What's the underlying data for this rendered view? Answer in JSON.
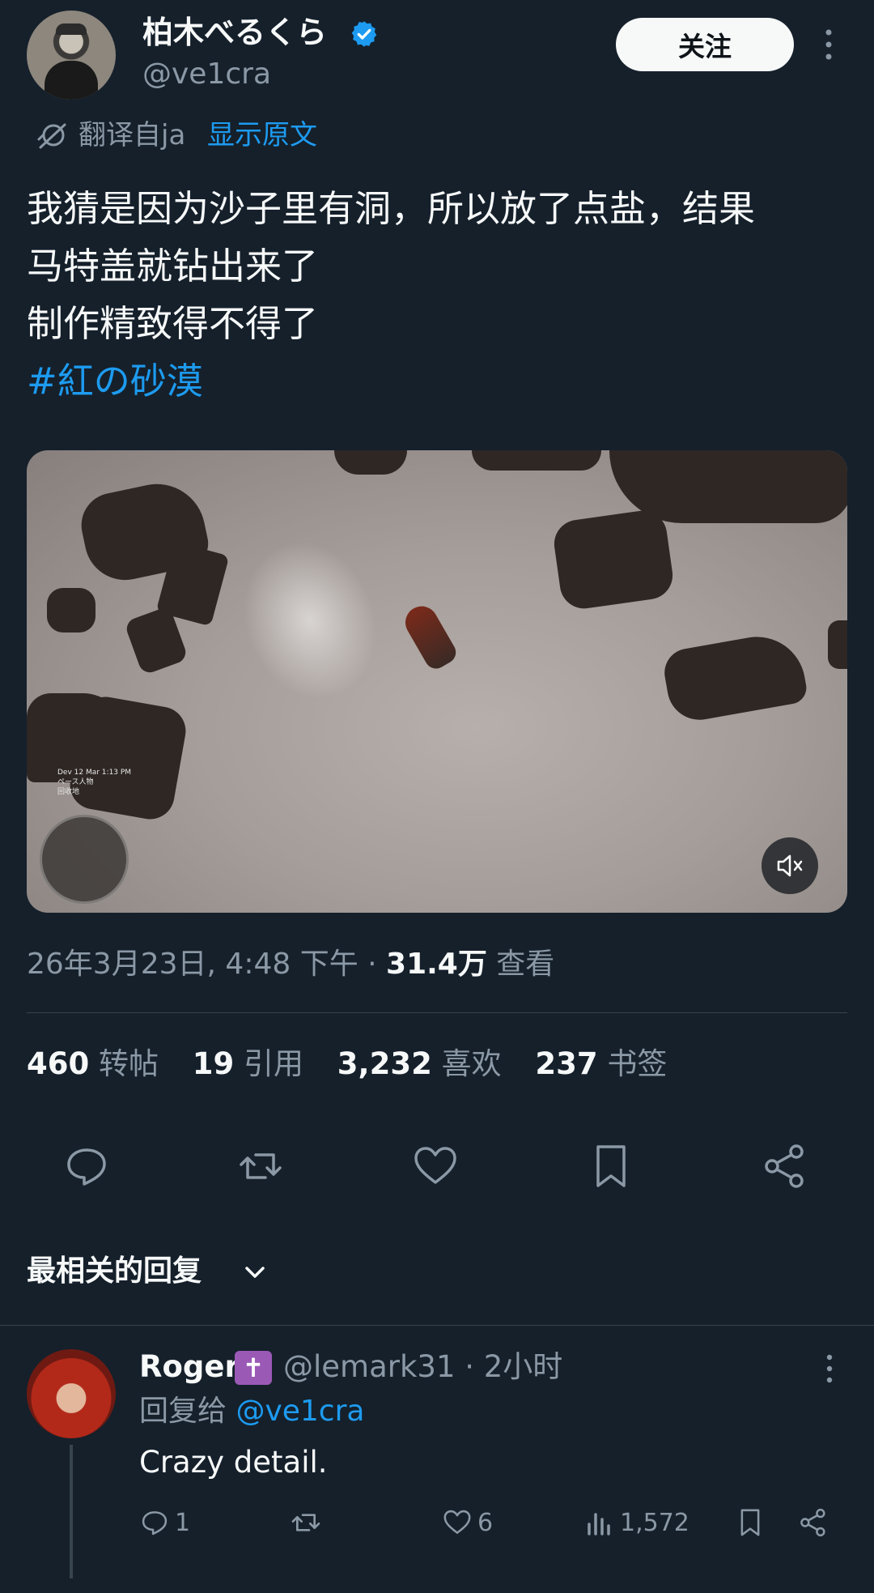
{
  "author": {
    "display_name": "柏木べるくら",
    "handle": "@ve1cra",
    "verified": true,
    "follow_label": "关注"
  },
  "translation": {
    "label": "翻译自ja",
    "show_original": "显示原文"
  },
  "tweet": {
    "lines": [
      "我猜是因为沙子里有洞，所以放了点盐，结果",
      "马特盖就钻出来了",
      "制作精致得不得了"
    ],
    "hashtag": "#紅の砂漠"
  },
  "media": {
    "hud_lines": [
      "Dev 12 Mar 1:13 PM",
      "ペース人物",
      "回收地"
    ]
  },
  "meta": {
    "date": "26年3月23日, 4:48 下午 · ",
    "views": "31.4万",
    "views_label": " 查看"
  },
  "stats": {
    "reposts": "460",
    "reposts_label": "转帖",
    "quotes": "19",
    "quotes_label": "引用",
    "likes": "3,232",
    "likes_label": "喜欢",
    "bookmarks": "237",
    "bookmarks_label": "书签"
  },
  "replies_header": "最相关的回复",
  "reply": {
    "name": "Roger",
    "emoji": "✝",
    "handle_time": "@lemark31 · 2小时",
    "replying_to_prefix": "回复给 ",
    "replying_to_handle": "@ve1cra",
    "text": "Crazy detail.",
    "replies": "1",
    "likes": "6",
    "views": "1,572"
  },
  "colors": {
    "background": "#15202b",
    "accent": "#1d9bf0",
    "secondary_text": "#8b98a5",
    "divider": "#38444d"
  }
}
